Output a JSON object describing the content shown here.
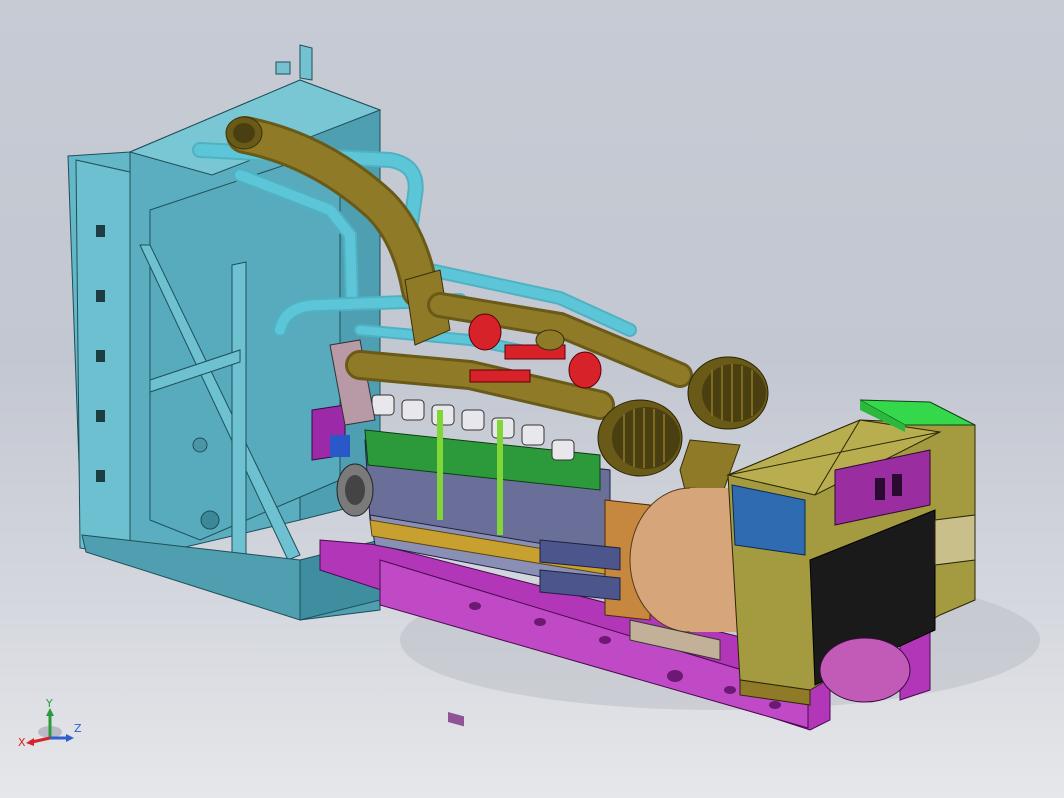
{
  "viewport": {
    "background_top": "#c7cbd4",
    "background_bottom": "#e6e7ea"
  },
  "model": {
    "colors": {
      "radiator_frame": "#5fb4c4",
      "radiator_shade": "#3f8fa0",
      "intake_duct": "#8f7a28",
      "coolant_pipe": "#5cc6d8",
      "turbo_red": "#d8222a",
      "base_frame": "#b236b8",
      "engine_block": "#6a6f99",
      "rocker_cover": "#2c9a3a",
      "generator_housing": "#a49a40",
      "generator_rotor": "#d7a57a",
      "control_box_top": "#35d84a",
      "control_panel_blue": "#2f6bb0",
      "flywheel_disc": "#c25ab8"
    },
    "icons": [
      "radiator-icon",
      "air-filter-icon",
      "generator-icon"
    ]
  },
  "triad": {
    "x_label": "X",
    "y_label": "Y",
    "z_label": "Z",
    "x_color": "#d8222a",
    "y_color": "#2c9a3a",
    "z_color": "#2f5fcf"
  }
}
